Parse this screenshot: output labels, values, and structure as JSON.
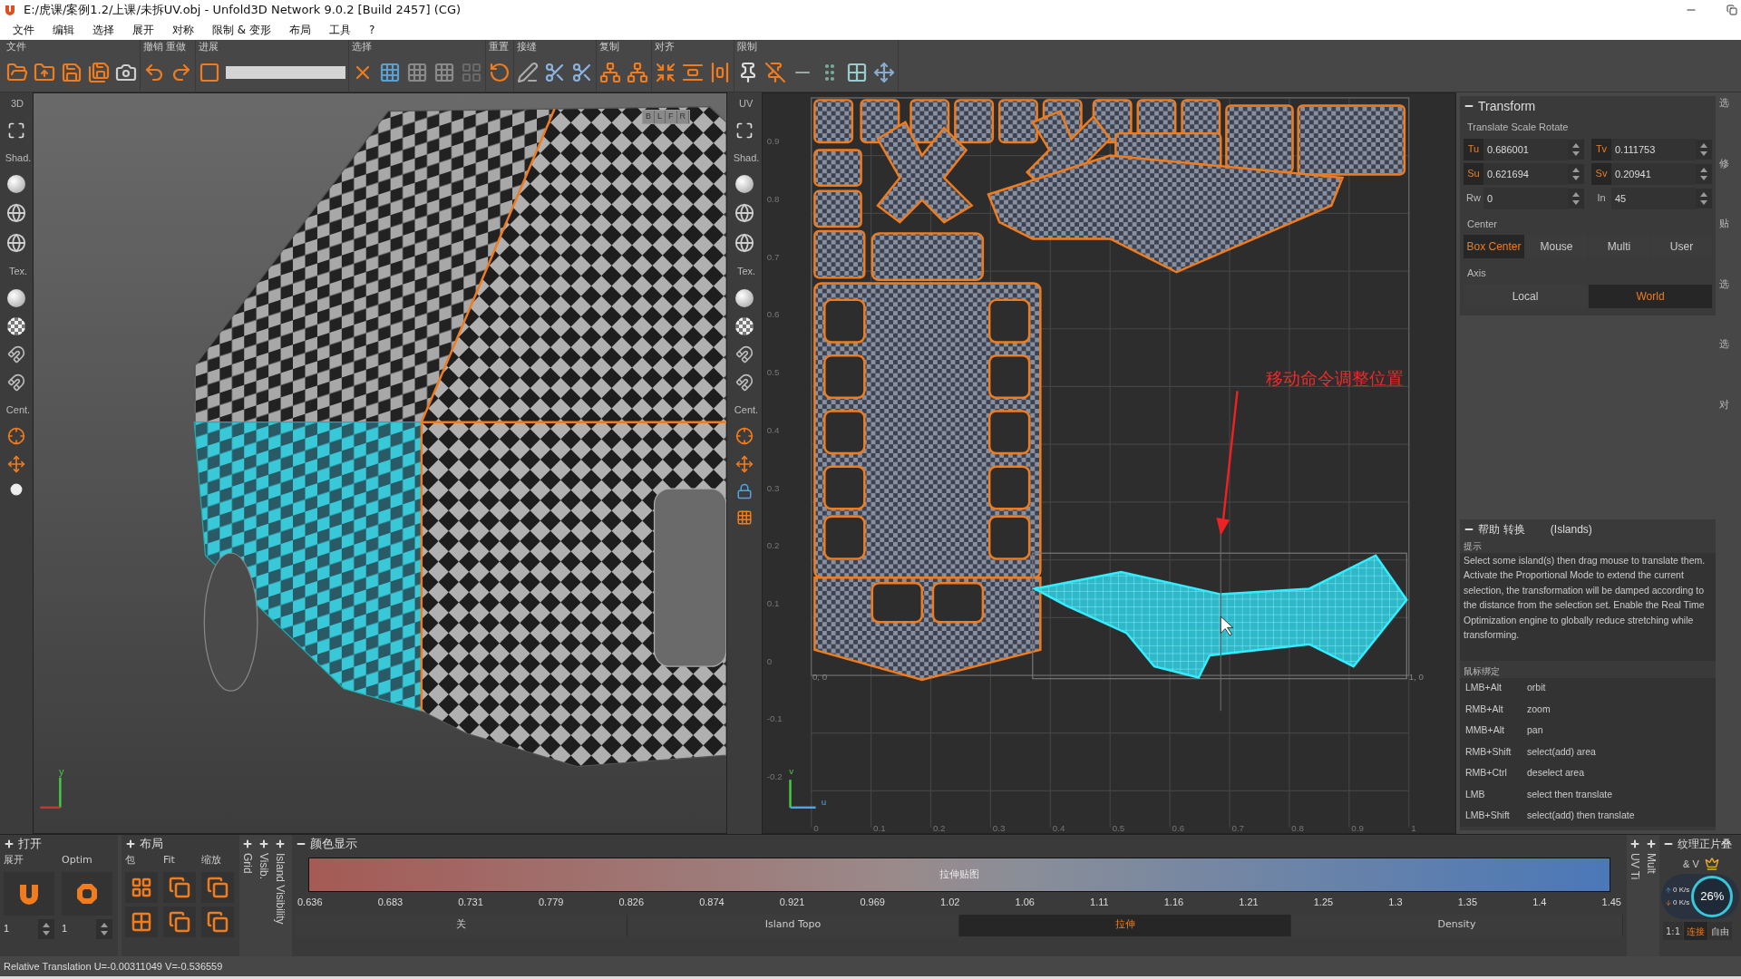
{
  "window": {
    "title": "E:/虎课/案例1.2/上课/未拆UV.obj - Unfold3D Network 9.0.2 [Build 2457] (CG)"
  },
  "menu": [
    "文件",
    "编辑",
    "选择",
    "展开",
    "对称",
    "限制 & 变形",
    "布局",
    "工具",
    "?"
  ],
  "toolbar_groups": [
    "文件",
    "撤销 重做",
    "进展",
    "选择",
    "重置",
    "接缝",
    "复制",
    "对齐",
    "限制"
  ],
  "progress": {
    "level": 1
  },
  "left_toolbar": [
    "3D",
    "Shad.",
    "Tex.",
    "Cent."
  ],
  "viewport_3d": {
    "view_cube": [
      "B",
      "L",
      "F",
      "R"
    ],
    "axis_label": "y"
  },
  "uv_toolbar": [
    "UV",
    "Shad.",
    "Tex.",
    "Cent."
  ],
  "uv_viewport": {
    "v_ticks": [
      "0.9",
      "0.8",
      "0.7",
      "0.6",
      "0.5",
      "0.4",
      "0.3",
      "0.2",
      "0.1",
      "0",
      "-0.1",
      "-0.2"
    ],
    "u_ticks": [
      "0",
      "0.1",
      "0.2",
      "0.3",
      "0.4",
      "0.5",
      "0.6",
      "0.7",
      "0.8",
      "0.9",
      "1"
    ],
    "origin_label": "0, 0",
    "corner_label": "1, 0",
    "axis_labels": [
      "v",
      "u"
    ],
    "annotation": "移动命令调整位置"
  },
  "transform": {
    "title": "Transform",
    "expanded": true,
    "subtitle": "Translate Scale Rotate",
    "fields": [
      {
        "label": "Tu",
        "value": "0.686001",
        "highlighted": true
      },
      {
        "label": "Tv",
        "value": "0.111753",
        "highlighted": true
      },
      {
        "label": "Su",
        "value": "0.621694",
        "highlighted": true
      },
      {
        "label": "Sv",
        "value": "0.20941",
        "highlighted": true
      },
      {
        "label": "Rw",
        "value": "0",
        "highlighted": false
      },
      {
        "label": "In",
        "value": "45",
        "highlighted": false
      }
    ],
    "center_label": "Center",
    "center_options": [
      {
        "label": "Box Center",
        "selected": true
      },
      {
        "label": "Mouse",
        "selected": false
      },
      {
        "label": "Multi",
        "selected": false
      },
      {
        "label": "User",
        "selected": false
      }
    ],
    "axis_label": "Axis",
    "axis_options": [
      {
        "label": "Local",
        "selected": false
      },
      {
        "label": "World",
        "selected": true
      }
    ]
  },
  "help": {
    "title": "帮助 转换",
    "context": "(Islands)",
    "expanded": true,
    "hint_label": "提示",
    "hint": "Select some island(s) then drag mouse to translate them. Activate the Proportional Mode to extend the current selection, the transformation will be damped according to the distance from the selection set. Enable the Real Time Optimization engine to globally reduce stretching while transforming.",
    "bindings_label": "鼠标绑定",
    "bindings": [
      {
        "keys": "LMB+Alt",
        "action": "orbit"
      },
      {
        "keys": "RMB+Alt",
        "action": "zoom"
      },
      {
        "keys": "MMB+Alt",
        "action": "pan"
      },
      {
        "keys": "RMB+Shift",
        "action": "select(add) area"
      },
      {
        "keys": "RMB+Ctrl",
        "action": "deselect area"
      },
      {
        "keys": "LMB",
        "action": "select then translate"
      },
      {
        "keys": "LMB+Shift",
        "action": "select(add) then translate"
      }
    ]
  },
  "side_tabs": [
    "选",
    "修",
    "贴",
    "选",
    "选",
    "对"
  ],
  "bottom": {
    "open": {
      "title": "打开",
      "expanded": false,
      "columns": [
        {
          "label": "展开",
          "value": "1"
        },
        {
          "label": "Optim",
          "value": "1"
        }
      ]
    },
    "layout": {
      "title": "布局",
      "expanded": false,
      "columns": [
        "包",
        "Fit",
        "缩放"
      ]
    },
    "collapsed": [
      {
        "label": "Grid",
        "expanded": false
      },
      {
        "label": "Visib.",
        "expanded": false
      },
      {
        "label": "Island Visibility",
        "expanded": false
      }
    ],
    "color_display": {
      "title": "颜色显示",
      "expanded": true,
      "bar_label": "拉伸贴图",
      "ticks": [
        "0.636",
        "0.683",
        "0.731",
        "0.779",
        "0.826",
        "0.874",
        "0.921",
        "0.969",
        "1.02",
        "1.06",
        "1.11",
        "1.16",
        "1.21",
        "1.25",
        "1.3",
        "1.35",
        "1.4",
        "1.45"
      ],
      "tabs": [
        {
          "label": "关",
          "selected": false
        },
        {
          "label": "Island Topo",
          "selected": false
        },
        {
          "label": "拉伸",
          "selected": true
        },
        {
          "label": "Density",
          "selected": false
        }
      ]
    },
    "right_collapsed": [
      {
        "label": "UV Ti",
        "expanded": false
      },
      {
        "label": "Mult",
        "expanded": false
      }
    ],
    "texture": {
      "title": "纹理正片叠",
      "expanded": true,
      "row_label": "& V",
      "buttons": [
        {
          "label": "1:1",
          "selected": false
        },
        {
          "label": "连接",
          "selected": true
        },
        {
          "label": "自由",
          "selected": false
        }
      ]
    }
  },
  "network_widget": {
    "percent": "26%",
    "upload": "0 K/s",
    "download": "0 K/s"
  },
  "status_bar": "Relative Translation U=-0.00311049 V=-0.536559"
}
